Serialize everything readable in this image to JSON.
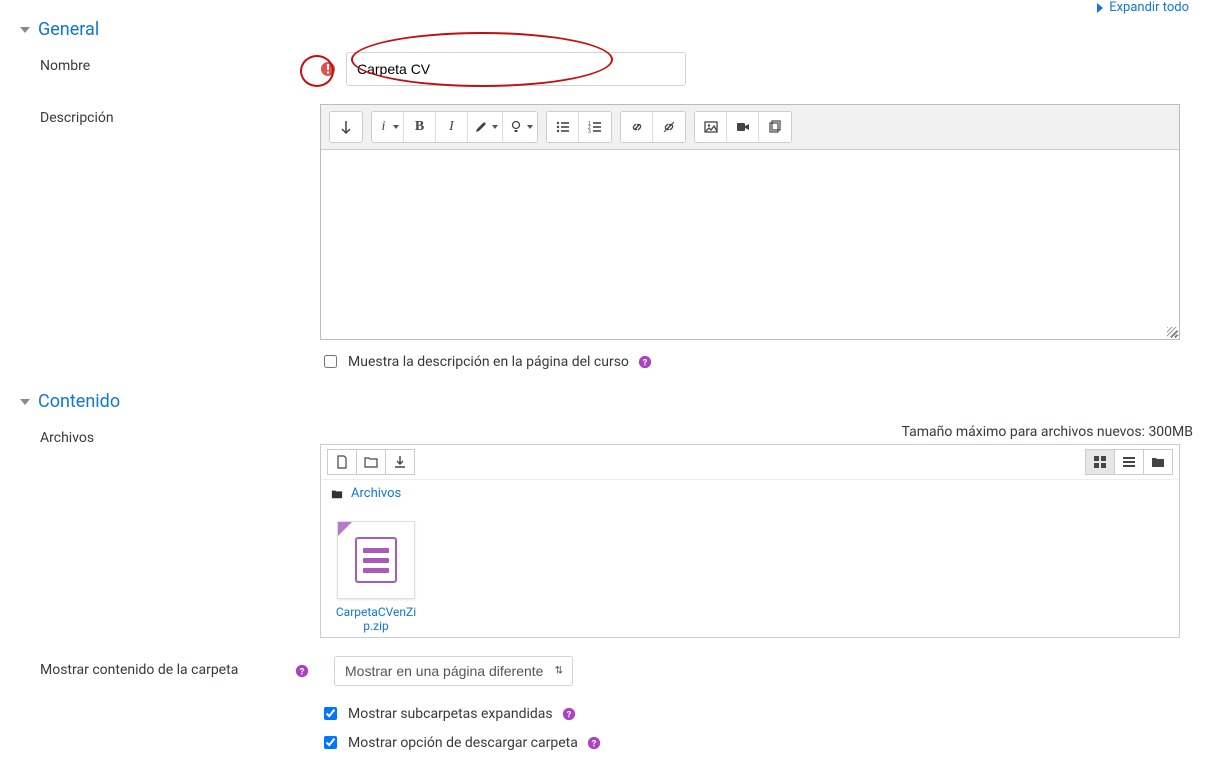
{
  "top": {
    "expand_all": "Expandir todo"
  },
  "colors": {
    "link": "#1177d1",
    "help": "#ac41c2",
    "alert": "#c40f0f"
  },
  "general": {
    "title": "General",
    "nombre_label": "Nombre",
    "nombre_value": "Carpeta CV",
    "descripcion_label": "Descripción",
    "show_desc_label": "Muestra la descripción en la página del curso",
    "show_desc_checked": false
  },
  "contenido": {
    "title": "Contenido",
    "archivos_label": "Archivos",
    "max_size_text": "Tamaño máximo para archivos nuevos: 300MB",
    "breadcrumb_root": "Archivos",
    "file_name": "CarpetaCVenZip.zip",
    "mostrar_contenido_label": "Mostrar contenido de la carpeta",
    "mostrar_contenido_value": "Mostrar en una página diferente",
    "subcarpetas_label": "Mostrar subcarpetas expandidas",
    "subcarpetas_checked": true,
    "descargar_label": "Mostrar opción de descargar carpeta",
    "descargar_checked": true
  }
}
